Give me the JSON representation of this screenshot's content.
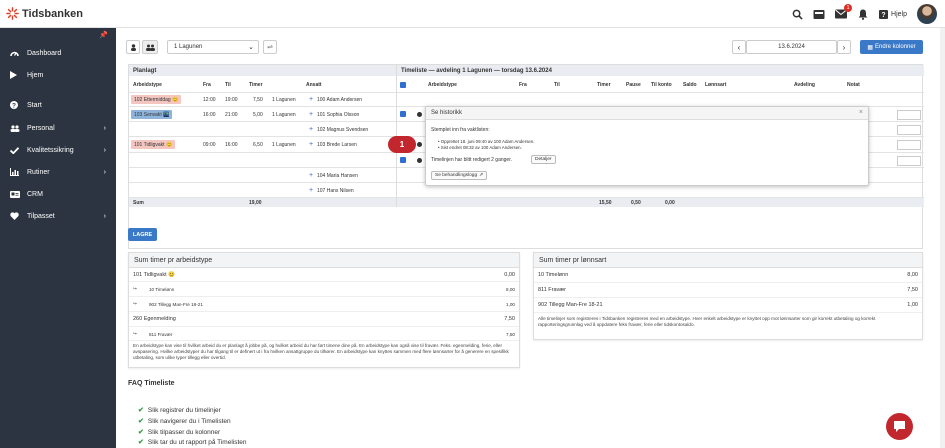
{
  "brand": {
    "name": "Tidsbanken"
  },
  "topbar": {
    "notification_count": "1",
    "help_label": "Hjelp"
  },
  "sidebar": {
    "items": [
      {
        "label": "Dashboard",
        "icon": "dashboard-icon"
      },
      {
        "label": "Hjem",
        "icon": "play-icon"
      },
      {
        "label": "Start",
        "icon": "help-circle-icon"
      },
      {
        "label": "Personal",
        "icon": "people-icon",
        "has_submenu": true
      },
      {
        "label": "Kvalitetssikring",
        "icon": "check-icon",
        "has_submenu": true
      },
      {
        "label": "Rutiner",
        "icon": "chart-icon",
        "has_submenu": true
      },
      {
        "label": "CRM",
        "icon": "card-icon"
      },
      {
        "label": "Tilpasset",
        "icon": "heart-icon",
        "has_submenu": true
      }
    ]
  },
  "toolbar": {
    "department": "1 Lagunen",
    "date": "13.6.2024",
    "change_columns": "Endre kolonner"
  },
  "planned": {
    "title": "Planlagt",
    "columns": [
      "Arbeidstype",
      "Fra",
      "Til",
      "Timer",
      "Ansatt"
    ],
    "rows": [
      {
        "type": "102 Ettermiddag 😊",
        "type_color": "#f4c6c0",
        "fra": "12:00",
        "til": "19:00",
        "timer": "7,50",
        "avd": "1 Lagunen",
        "ansatt": "100 Adam Andersen"
      },
      {
        "type": "103 Senvakt 🌃",
        "type_color": "#8fb4db",
        "fra": "16:00",
        "til": "21:00",
        "timer": "5,00",
        "avd": "1 Lagunen",
        "ansatt": "101 Sophia Olsson"
      },
      {
        "type": "",
        "type_color": "",
        "fra": "",
        "til": "",
        "timer": "",
        "avd": "",
        "ansatt": "102 Magnus Svendsen"
      },
      {
        "type": "101 Tidligvakt 😊",
        "type_color": "#f4c6c0",
        "fra": "09:00",
        "til": "16:00",
        "timer": "6,50",
        "avd": "1 Lagunen",
        "ansatt": "103 Brede Larsen"
      },
      {
        "type": "",
        "type_color": "",
        "fra": "",
        "til": "",
        "timer": "",
        "avd": "",
        "ansatt": ""
      },
      {
        "type": "",
        "type_color": "",
        "fra": "",
        "til": "",
        "timer": "",
        "avd": "",
        "ansatt": "104 Maria Hansen"
      },
      {
        "type": "",
        "type_color": "",
        "fra": "",
        "til": "",
        "timer": "",
        "avd": "",
        "ansatt": "107 Hans Nilsen"
      }
    ],
    "sum_label": "Sum",
    "sum_timer": "19,00"
  },
  "timeliste": {
    "title": "Timeliste — avdeling 1 Lagunen — torsdag 13.6.2024",
    "columns": [
      "Arbeidstype",
      "Fra",
      "Til",
      "Timer",
      "Pause",
      "Til konto",
      "Saldo",
      "Lønnsart",
      "Avdeling",
      "Notat"
    ],
    "sum_timer": "15,50",
    "sum_pause": "0,50",
    "sum_konto": "0,00"
  },
  "popup": {
    "title": "Se historikk",
    "stamped": "Stemplet inn fra vaktlisten:",
    "bullets": [
      "Opprettet 18. juni 09:40 av 100 Adam Andersen.",
      "Sist endret 08:32 av 100 Adam Andersen."
    ],
    "edited_text": "Timelinjen har blitt redigert 2 ganger.",
    "details_btn": "Detaljer",
    "see_handling_btn": "Se behandlingslogg",
    "close": "×"
  },
  "step_marker": "1",
  "save_button": "LAGRE",
  "panel_arbeidstype": {
    "title": "Sum timer pr arbeidstype",
    "rows": [
      {
        "label": "101 Tidligvakt 😊",
        "value": "0,00",
        "sub": false
      },
      {
        "label": "10 Timelønn",
        "value": "8,00",
        "sub": true
      },
      {
        "label": "902 Tillegg Man-Fre 18-21",
        "value": "1,00",
        "sub": true
      },
      {
        "label": "260 Egenmelding",
        "value": "7,50",
        "sub": false
      },
      {
        "label": "811 Fravær",
        "value": "7,50",
        "sub": true
      }
    ],
    "note": "En arbeidstype kan vise til hvilket arbeid du er planlagt å jobbe på, og hvilket arbeid du har ført timene dine på. En arbeidstype kan også vise til fravær. Feks. egenmelding, ferie, eller avspasering. Hvilke arbeidstyper du har tilgang til er definert ut i fra hvilken ansattgruppe du tilhører. En arbeidstype kan knyttes sammen med flere lønnsarter for å generere en spesifikk utbetaling, som ulike typer tillegg eller overtid."
  },
  "panel_lonnsart": {
    "title": "Sum timer pr lønnsart",
    "rows": [
      {
        "label": "10 Timelønn",
        "value": "8,00"
      },
      {
        "label": "811 Fravær",
        "value": "7,50"
      },
      {
        "label": "902 Tillegg Man-Fre 18-21",
        "value": "1,00"
      }
    ],
    "note": "Alle timelinjer som registreres i Tidsbanken registreres med en arbeidstype. Hver enkelt arbeidstype er knyttet opp mot lønnsarter som gir korrekt utbetaling og korrekt rapporteringsgrunnlag ved å oppdatere feks fravær, ferie eller tidskontosaldo."
  },
  "faq": {
    "title": "FAQ Timeliste",
    "items": [
      "Slik registrer du timelinjer",
      "Slik navigerer du i Timelisten",
      "Slik tilpasser du kolonner",
      "Slik tar du ut rapport på Timelisten"
    ]
  }
}
